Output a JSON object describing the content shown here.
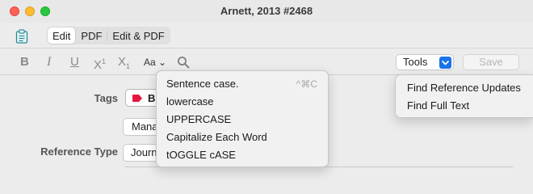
{
  "window": {
    "title": "Arnett, 2013 #2468"
  },
  "mode_bar": {
    "icon": "clipboard-icon",
    "options": [
      "Edit",
      "PDF",
      "Edit & PDF"
    ],
    "selected": "Edit"
  },
  "format_bar": {
    "bold": "B",
    "italic": "I",
    "underline": "U",
    "superscript": {
      "base": "X",
      "mark": "1"
    },
    "subscript": {
      "base": "X",
      "mark": "1"
    },
    "case_menu_label": "Aa",
    "case_menu_chevron": "⌄",
    "search_icon": "search-icon",
    "tools_label": "Tools",
    "save_label": "Save"
  },
  "fields": {
    "tags_label": "Tags",
    "tag_value": "B",
    "tag_color": "#e5173f",
    "manage_label": "Mana",
    "reference_type_label": "Reference Type",
    "reference_type_value": "Journ"
  },
  "case_menu": {
    "items": [
      {
        "label": "Sentence case.",
        "shortcut": "^⌘C"
      },
      {
        "label": "lowercase"
      },
      {
        "label": "UPPERCASE"
      },
      {
        "label": "Capitalize Each Word"
      },
      {
        "label": "tOGGLE cASE"
      }
    ]
  },
  "tools_menu": {
    "items": [
      {
        "label": "Find Reference Updates"
      },
      {
        "label": "Find Full Text"
      }
    ]
  },
  "colors": {
    "accent": "#1a73e8",
    "close": "#ff5f57",
    "minimize": "#febc2e",
    "zoom": "#28c840"
  }
}
